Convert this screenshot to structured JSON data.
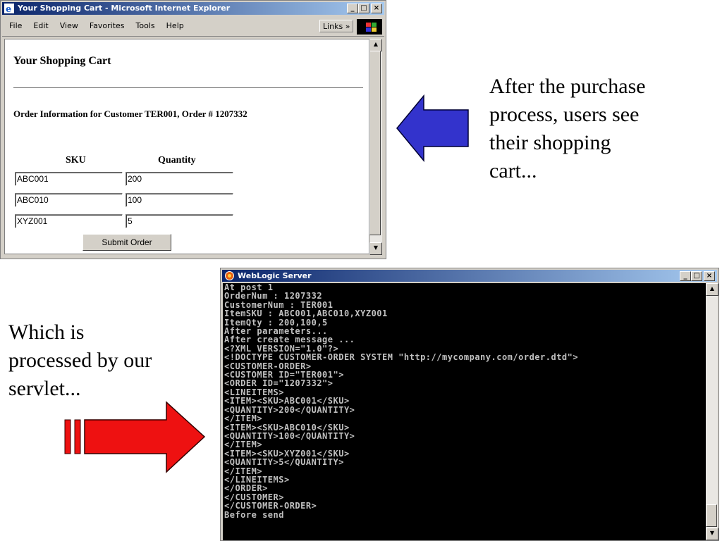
{
  "ie_window": {
    "title": "Your Shopping Cart - Microsoft Internet Explorer",
    "menu": [
      "File",
      "Edit",
      "View",
      "Favorites",
      "Tools",
      "Help"
    ],
    "links_label": "Links »",
    "page": {
      "heading": "Your Shopping Cart",
      "order_info": "Order Information for Customer TER001, Order # 1207332",
      "sku_header": "SKU",
      "qty_header": "Quantity",
      "rows": [
        {
          "sku": "ABC001",
          "qty": "200"
        },
        {
          "sku": "ABC010",
          "qty": "100"
        },
        {
          "sku": "XYZ001",
          "qty": "5"
        }
      ],
      "submit_label": "Submit Order"
    }
  },
  "annotations": {
    "top_note": "After the purchase\nprocess, users see\ntheir shopping\ncart...",
    "bottom_note": "Which is\nprocessed by our\nservlet..."
  },
  "console_window": {
    "title": "WebLogic Server",
    "lines": [
      "At post 1",
      "OrderNum : 1207332",
      "CustomerNum : TER001",
      "ItemSKU : ABC001,ABC010,XYZ001",
      "ItemQty : 200,100,5",
      "After parameters...",
      "After create message ...",
      "<?XML VERSION=\"1.0\"?>",
      "<!DOCTYPE CUSTOMER-ORDER SYSTEM \"http://mycompany.com/order.dtd\">",
      "<CUSTOMER-ORDER>",
      "<CUSTOMER ID=\"TER001\">",
      "<ORDER ID=\"1207332\">",
      "<LINEITEMS>",
      "<ITEM><SKU>ABC001</SKU>",
      "<QUANTITY>200</QUANTITY>",
      "</ITEM>",
      "<ITEM><SKU>ABC010</SKU>",
      "<QUANTITY>100</QUANTITY>",
      "</ITEM>",
      "<ITEM><SKU>XYZ001</SKU>",
      "<QUANTITY>5</QUANTITY>",
      "</ITEM>",
      "</LINEITEMS>",
      "</ORDER>",
      "</CUSTOMER>",
      "</CUSTOMER-ORDER>",
      "Before send"
    ]
  },
  "colors": {
    "blue_arrow": "#3333cc",
    "red_arrow": "#ee1111",
    "titlebar": "#0a246a"
  }
}
